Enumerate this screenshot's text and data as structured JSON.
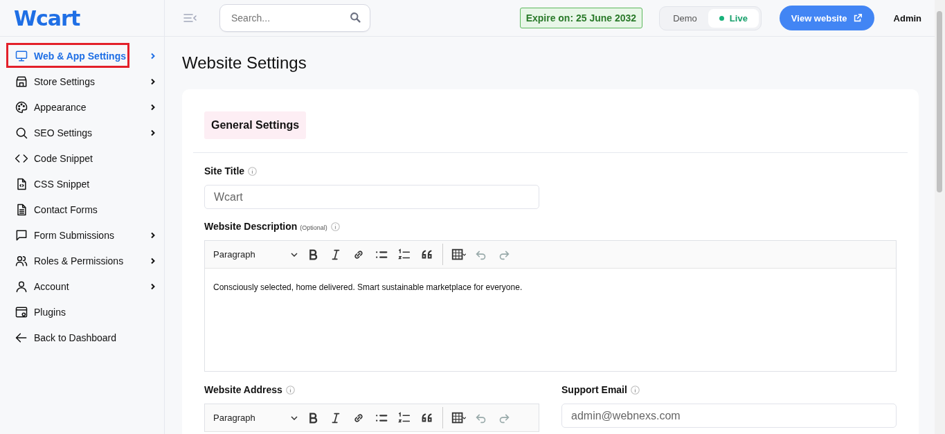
{
  "logo": {
    "text": "Wcart"
  },
  "sidebar": {
    "items": [
      {
        "label": "Web & App Settings",
        "has_submenu": true,
        "selected": true,
        "highlighted": true
      },
      {
        "label": "Store Settings",
        "has_submenu": true,
        "selected": false,
        "highlighted": false
      },
      {
        "label": "Appearance",
        "has_submenu": true,
        "selected": false,
        "highlighted": false
      },
      {
        "label": "SEO Settings",
        "has_submenu": true,
        "selected": false,
        "highlighted": false
      },
      {
        "label": "Code Snippet",
        "has_submenu": false,
        "selected": false,
        "highlighted": false
      },
      {
        "label": "CSS Snippet",
        "has_submenu": false,
        "selected": false,
        "highlighted": false
      },
      {
        "label": "Contact Forms",
        "has_submenu": false,
        "selected": false,
        "highlighted": false
      },
      {
        "label": "Form Submissions",
        "has_submenu": true,
        "selected": false,
        "highlighted": false
      },
      {
        "label": "Roles & Permissions",
        "has_submenu": true,
        "selected": false,
        "highlighted": false
      },
      {
        "label": "Account",
        "has_submenu": true,
        "selected": false,
        "highlighted": false
      },
      {
        "label": "Plugins",
        "has_submenu": false,
        "selected": false,
        "highlighted": false
      },
      {
        "label": "Back to Dashboard",
        "has_submenu": false,
        "selected": false,
        "highlighted": false
      }
    ]
  },
  "header": {
    "search": {
      "placeholder": "Search..."
    },
    "expiry": "Expire on: 25 June 2032",
    "mode_toggle": [
      {
        "label": "Demo",
        "selected": false
      },
      {
        "label": "Live",
        "selected": true
      }
    ],
    "view_button": "View website",
    "user": "Admin"
  },
  "page_title": "Website Settings",
  "section_tab": "General Settings",
  "site_title": {
    "label": "Site Title",
    "value": "Wcart"
  },
  "description": {
    "label": "Website Description",
    "note": "(Optional)",
    "format": "Paragraph",
    "text": "Consciously selected, home delivered. Smart sustainable marketplace for everyone."
  },
  "address": {
    "label": "Website Address",
    "format": "Paragraph"
  },
  "support_email": {
    "label": "Support Email",
    "value": "admin@webnexs.com"
  }
}
